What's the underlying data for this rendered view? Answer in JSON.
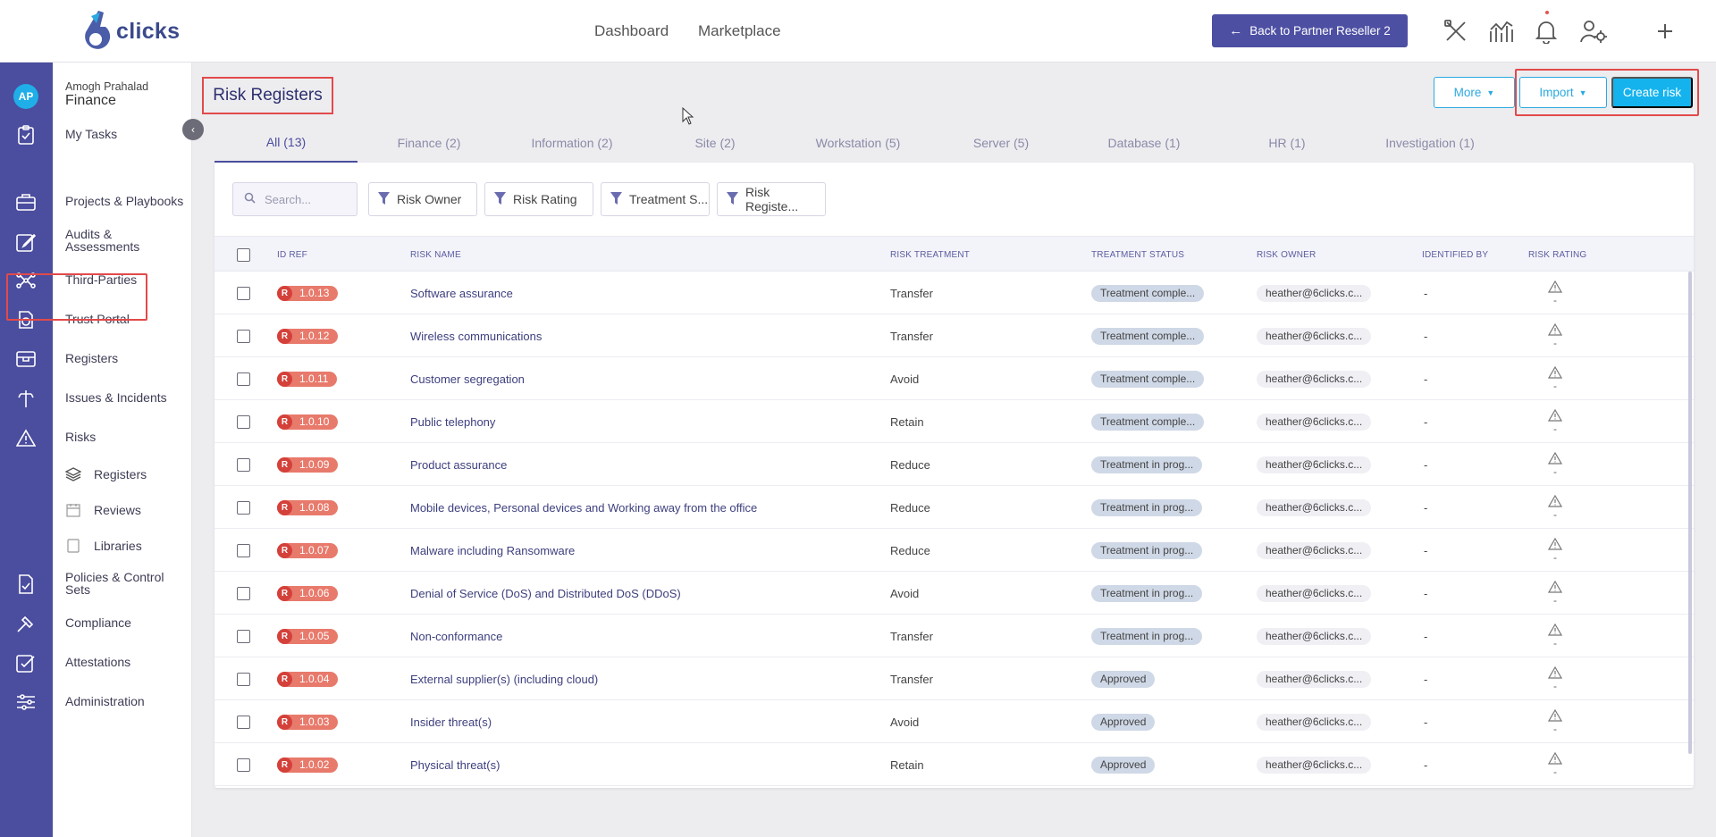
{
  "brand": {
    "logo_text": "clicks"
  },
  "topnav": {
    "dashboard": "Dashboard",
    "marketplace": "Marketplace",
    "back_label": "Back to Partner Reseller 2"
  },
  "user": {
    "initials": "AP",
    "name": "Amogh Prahalad",
    "org": "Finance"
  },
  "sidebar": {
    "my_tasks": "My Tasks",
    "items": [
      "Projects & Playbooks",
      "Audits & Assessments",
      "Third-Parties",
      "Trust Portal",
      "Registers",
      "Issues & Incidents",
      "Risks"
    ],
    "risk_sub": [
      "Registers",
      "Reviews",
      "Libraries"
    ],
    "items2": [
      "Policies & Control Sets",
      "Compliance",
      "Attestations",
      "Administration"
    ]
  },
  "page": {
    "title": "Risk Registers",
    "more": "More",
    "import": "Import",
    "create": "Create risk"
  },
  "tabs": [
    "All (13)",
    "Finance (2)",
    "Information (2)",
    "Site (2)",
    "Workstation (5)",
    "Server (5)",
    "Database (1)",
    "HR (1)",
    "Investigation (1)"
  ],
  "filters": {
    "search_placeholder": "Search...",
    "items": [
      "Risk Owner",
      "Risk Rating",
      "Treatment S...",
      "Risk Registe..."
    ]
  },
  "columns": [
    "ID REF",
    "RISK NAME",
    "RISK TREATMENT",
    "TREATMENT STATUS",
    "RISK OWNER",
    "IDENTIFIED BY",
    "RISK RATING"
  ],
  "badge_letter": "R",
  "rows": [
    {
      "id": "1.0.13",
      "name": "Software assurance",
      "treatment": "Transfer",
      "status": "Treatment comple...",
      "owner": "heather@6clicks.c...",
      "identified": "-",
      "rating": "-"
    },
    {
      "id": "1.0.12",
      "name": "Wireless communications",
      "treatment": "Transfer",
      "status": "Treatment comple...",
      "owner": "heather@6clicks.c...",
      "identified": "-",
      "rating": "-"
    },
    {
      "id": "1.0.11",
      "name": "Customer segregation",
      "treatment": "Avoid",
      "status": "Treatment comple...",
      "owner": "heather@6clicks.c...",
      "identified": "-",
      "rating": "-"
    },
    {
      "id": "1.0.10",
      "name": "Public telephony",
      "treatment": "Retain",
      "status": "Treatment comple...",
      "owner": "heather@6clicks.c...",
      "identified": "-",
      "rating": "-"
    },
    {
      "id": "1.0.09",
      "name": "Product assurance",
      "treatment": "Reduce",
      "status": "Treatment in prog...",
      "owner": "heather@6clicks.c...",
      "identified": "-",
      "rating": "-"
    },
    {
      "id": "1.0.08",
      "name": "Mobile devices, Personal devices and Working away from the office",
      "treatment": "Reduce",
      "status": "Treatment in prog...",
      "owner": "heather@6clicks.c...",
      "identified": "-",
      "rating": "-"
    },
    {
      "id": "1.0.07",
      "name": "Malware including Ransomware",
      "treatment": "Reduce",
      "status": "Treatment in prog...",
      "owner": "heather@6clicks.c...",
      "identified": "-",
      "rating": "-"
    },
    {
      "id": "1.0.06",
      "name": "Denial of Service (DoS) and Distributed DoS (DDoS)",
      "treatment": "Avoid",
      "status": "Treatment in prog...",
      "owner": "heather@6clicks.c...",
      "identified": "-",
      "rating": "-"
    },
    {
      "id": "1.0.05",
      "name": "Non-conformance",
      "treatment": "Transfer",
      "status": "Treatment in prog...",
      "owner": "heather@6clicks.c...",
      "identified": "-",
      "rating": "-"
    },
    {
      "id": "1.0.04",
      "name": "External supplier(s) (including cloud)",
      "treatment": "Transfer",
      "status": "Approved",
      "owner": "heather@6clicks.c...",
      "identified": "-",
      "rating": "-"
    },
    {
      "id": "1.0.03",
      "name": "Insider threat(s)",
      "treatment": "Avoid",
      "status": "Approved",
      "owner": "heather@6clicks.c...",
      "identified": "-",
      "rating": "-"
    },
    {
      "id": "1.0.02",
      "name": "Physical threat(s)",
      "treatment": "Retain",
      "status": "Approved",
      "owner": "heather@6clicks.c...",
      "identified": "-",
      "rating": "-"
    }
  ],
  "colors": {
    "rail": "#4b4d9e",
    "accent": "#14b3ee",
    "badge": "#e87a6c",
    "highlight": "#e24a4a"
  }
}
